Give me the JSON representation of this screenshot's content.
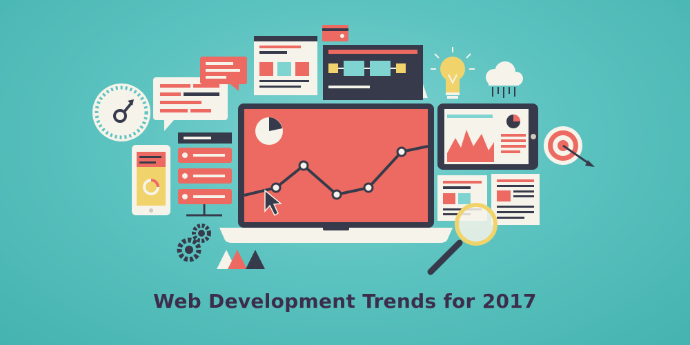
{
  "caption": "Web Development Trends for 2017",
  "colors": {
    "background": "#5cc3c0",
    "accent": "#ec6a61",
    "dark": "#363a4a",
    "light": "#f6f3ea",
    "yellow": "#f1d36b",
    "text": "#3c2d4b"
  },
  "icons": [
    "gauge-icon",
    "speech-bubble-icon",
    "web-page-icon",
    "credit-card-icon",
    "flowchart-window-icon",
    "lightbulb-icon",
    "cloud-icon",
    "smartphone-icon",
    "server-rack-icon",
    "laptop-icon",
    "tablet-icon",
    "target-icon",
    "documents-icon",
    "magnifier-icon",
    "gears-icon",
    "triangles-icon"
  ]
}
